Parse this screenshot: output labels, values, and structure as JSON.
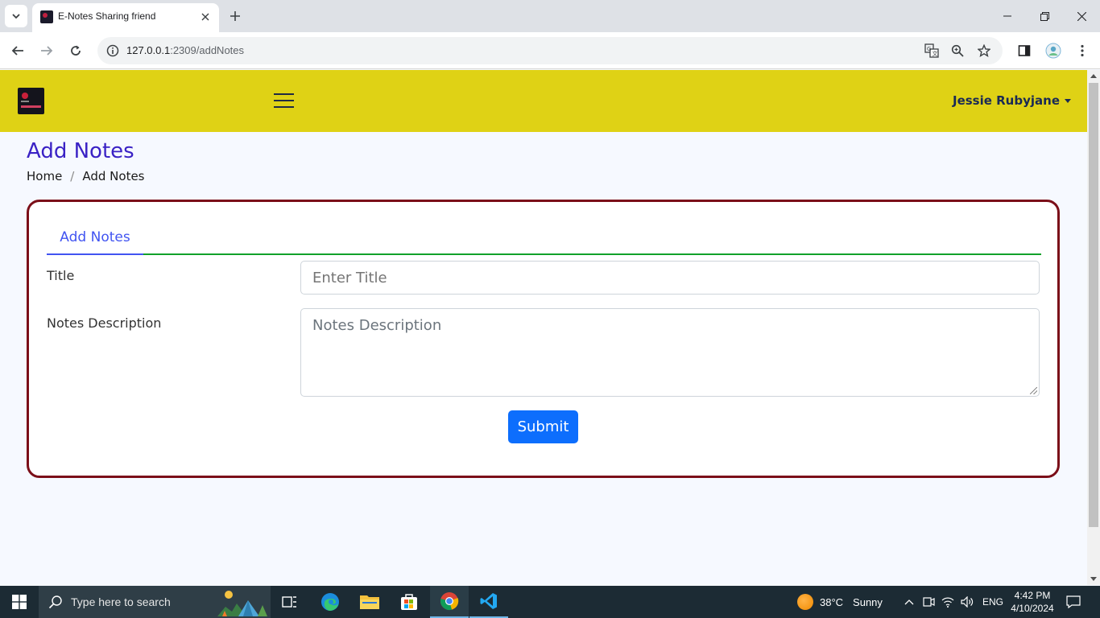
{
  "browser": {
    "tab_title": "E-Notes Sharing friend",
    "url_host": "127.0.0.1",
    "url_path": ":2309/addNotes"
  },
  "header": {
    "user_name": "Jessie Rubyjane"
  },
  "page": {
    "title": "Add Notes",
    "breadcrumb": [
      "Home",
      "/",
      "Add Notes"
    ]
  },
  "form": {
    "tab_label": "Add Notes",
    "title_label": "Title",
    "title_placeholder": "Enter Title",
    "title_value": "",
    "description_label": "Notes Description",
    "description_placeholder": "Notes Description",
    "description_value": "",
    "submit_label": "Submit"
  },
  "colors": {
    "header_bg": "#dfd215",
    "title_color": "#3a22c5",
    "card_border": "#7b0f19",
    "tab_active": "#4154f1",
    "tab_underline": "#12a12a",
    "submit_bg": "#0d6efd"
  },
  "taskbar": {
    "search_placeholder": "Type here to search",
    "weather_temp": "38°C",
    "weather_desc": "Sunny",
    "language": "ENG",
    "time": "4:42 PM",
    "date": "4/10/2024",
    "pinned_icons": [
      "task-view-icon",
      "edge-icon",
      "file-explorer-icon",
      "store-icon",
      "chrome-icon",
      "vscode-icon"
    ]
  }
}
